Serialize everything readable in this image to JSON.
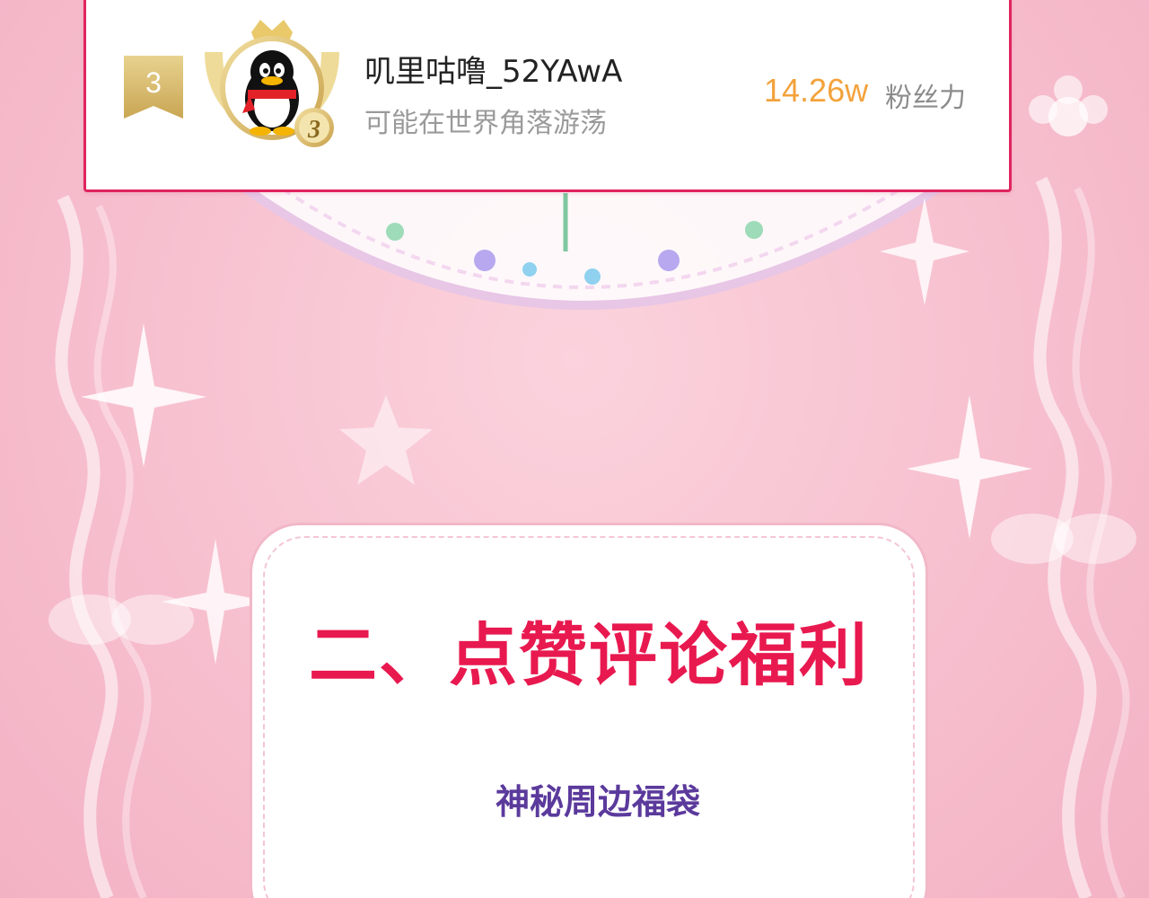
{
  "theme": {
    "accent": "#e0245e",
    "title_color": "#e8194f",
    "subtitle_color": "#5b3a9c",
    "fan_value_color": "#f3a23c",
    "background": "#f7c0cf"
  },
  "rank_entry": {
    "rank": "3",
    "avatar_badge": "3",
    "avatar_icon": "qq-penguin-icon",
    "name": "叽里咕噜_52YAwA",
    "status": "可能在世界角落游荡",
    "fan_value": "14.26w",
    "fan_label": "粉丝力"
  },
  "content": {
    "title": "二、点赞评论福利",
    "subtitle": "神秘周边福袋"
  }
}
